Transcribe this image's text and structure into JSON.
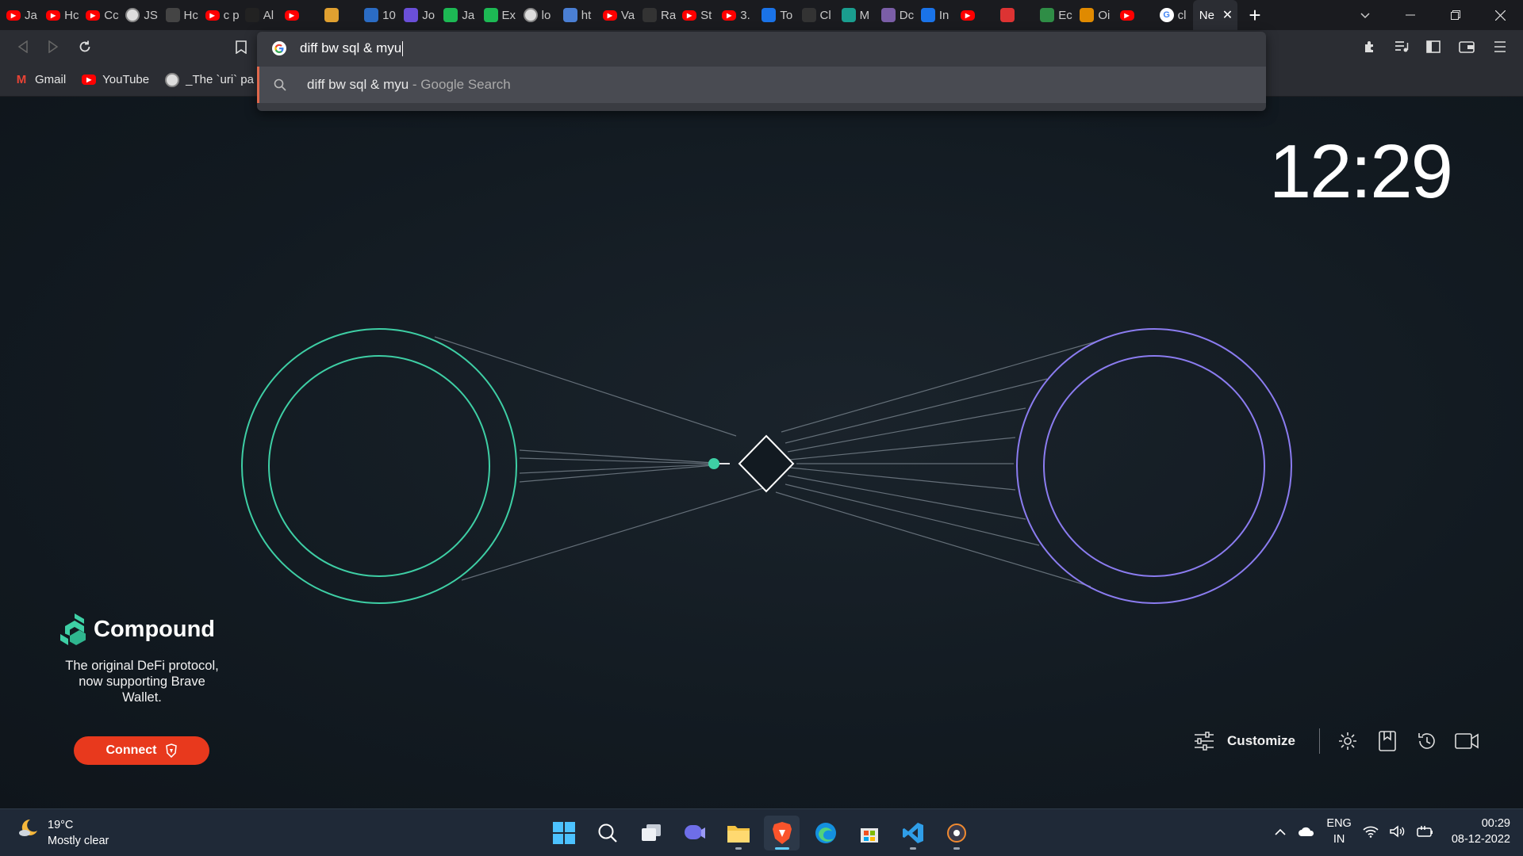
{
  "tabs": [
    {
      "fav": "youtube-icon",
      "title": "Ja",
      "color": "#ff0000"
    },
    {
      "fav": "youtube-icon",
      "title": "Hc",
      "color": "#ff0000"
    },
    {
      "fav": "youtube-icon",
      "title": "Cc",
      "color": "#ff0000"
    },
    {
      "fav": "globe-icon",
      "title": "JS",
      "color": "#666"
    },
    {
      "fav": "terminal-icon",
      "title": "Hc",
      "color": "#444"
    },
    {
      "fav": "youtube-icon",
      "title": "c p",
      "color": "#ff0000"
    },
    {
      "fav": "amazon-icon",
      "title": "Al",
      "color": "#222"
    },
    {
      "fav": "youtube-icon",
      "title": "",
      "color": "#ff0000"
    },
    {
      "fav": "hand-icon",
      "title": "",
      "color": "#e0a030"
    },
    {
      "fav": "gear-icon",
      "title": "10",
      "color": "#2b6cc4"
    },
    {
      "fav": "list-icon",
      "title": "Jo",
      "color": "#6a4fd8"
    },
    {
      "fav": "w-icon",
      "title": "Ja",
      "color": "#1db954"
    },
    {
      "fav": "w-icon",
      "title": "Ex",
      "color": "#1db954"
    },
    {
      "fav": "globe-icon",
      "title": "lo",
      "color": "#666"
    },
    {
      "fav": "translate-icon",
      "title": "ht",
      "color": "#4a7fd4"
    },
    {
      "fav": "youtube-icon",
      "title": "Va",
      "color": "#ff0000"
    },
    {
      "fav": "github-icon",
      "title": "Ra",
      "color": "#333"
    },
    {
      "fav": "youtube-icon",
      "title": "St",
      "color": "#ff0000"
    },
    {
      "fav": "youtube-icon",
      "title": "3.",
      "color": "#ff0000"
    },
    {
      "fav": "edge-icon",
      "title": "To",
      "color": "#1a73e8"
    },
    {
      "fav": "m-icon",
      "title": "Cl",
      "color": "#333"
    },
    {
      "fav": "js-icon",
      "title": "M",
      "color": "#1a9e8f"
    },
    {
      "fav": "b-icon",
      "title": "Dc",
      "color": "#7b5ea7"
    },
    {
      "fav": "loop-icon",
      "title": "In",
      "color": "#1a73e8"
    },
    {
      "fav": "youtube-icon",
      "title": "",
      "color": "#ff0000"
    },
    {
      "fav": "record-icon",
      "title": "",
      "color": "#d33"
    },
    {
      "fav": "gfg-icon",
      "title": "Ec",
      "color": "#2f8d46"
    },
    {
      "fav": "sun-icon",
      "title": "Oi",
      "color": "#e08a00"
    },
    {
      "fav": "youtube-icon",
      "title": "",
      "color": "#ff0000"
    },
    {
      "fav": "google-icon",
      "title": "cl",
      "color": "#ffffff"
    },
    {
      "fav": "",
      "title": "Ne",
      "color": "#2b2d33",
      "active": true
    }
  ],
  "omnibox": {
    "query": "diff bw sql & myu",
    "suggestion_text": "diff bw sql & myu",
    "suggestion_suffix": "- Google Search"
  },
  "bookmarks": [
    {
      "icon": "gmail-icon",
      "label": "Gmail"
    },
    {
      "icon": "youtube-icon",
      "label": "YouTube"
    },
    {
      "icon": "globe-icon",
      "label": "_The `uri` pa"
    }
  ],
  "ntp": {
    "clock": "12:29",
    "brand": "Compound",
    "tagline": "The original DeFi protocol, now supporting Brave Wallet.",
    "connect_label": "Connect",
    "customize_label": "Customize"
  },
  "taskbar": {
    "temp": "19°C",
    "weather": "Mostly clear",
    "lang_1": "ENG",
    "lang_2": "IN",
    "time": "00:29",
    "date": "08-12-2022"
  },
  "colors": {
    "accent_green": "#3ecfa5",
    "accent_purple": "#8b7cf0",
    "connect_red": "#e8391d"
  }
}
